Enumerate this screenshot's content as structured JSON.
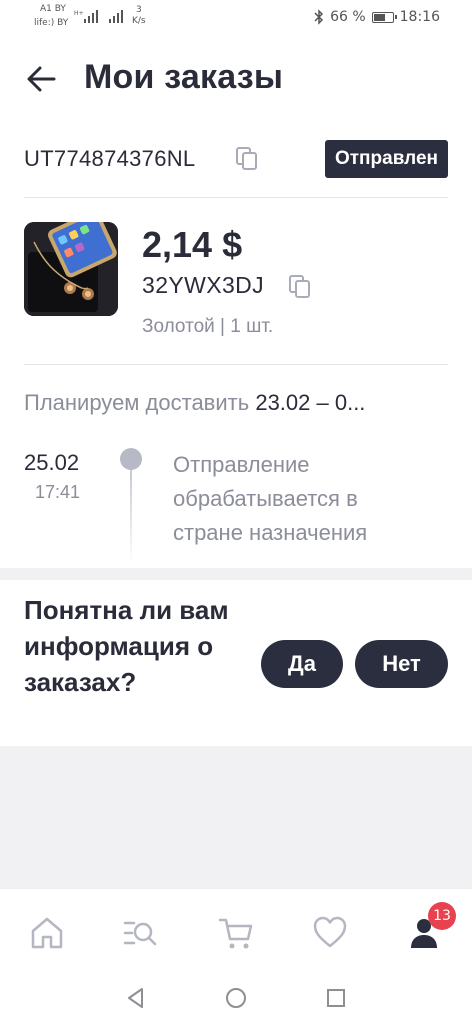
{
  "status_bar": {
    "operator_line1": "A1 BY",
    "operator_line2": "life:) BY",
    "speed_value": "3",
    "speed_unit": "K/s",
    "battery": "66 %",
    "battery_level": 0.66,
    "time": "18:16"
  },
  "header": {
    "title": "Мои заказы",
    "back_icon": "arrow-left-icon"
  },
  "order": {
    "tracking_number": "UT774874376NL",
    "status": "Отправлен",
    "price": "2,14 $",
    "sku": "32YWX3DJ",
    "variant": "Золотой | 1 шт.",
    "delivery_label": "Планируем доставить",
    "delivery_dates": "23.02 – 0..."
  },
  "timeline": [
    {
      "date": "25.02",
      "time": "17:41",
      "text": "Отправление обрабатывается в стране назначения"
    }
  ],
  "feedback": {
    "question": "Понятна ли вам информация о заказах?",
    "yes_label": "Да",
    "no_label": "Нет"
  },
  "bottom_nav": {
    "items": [
      "home-icon",
      "catalog-search-icon",
      "cart-icon",
      "favorites-heart-icon",
      "profile-icon"
    ],
    "badge_count": "13"
  },
  "colors": {
    "primary_dark": "#2b2e3f",
    "text_primary": "#2a2c3a",
    "text_secondary": "#8b8d99",
    "badge_red": "#e8414f",
    "background_grey": "#f1f1f4"
  }
}
